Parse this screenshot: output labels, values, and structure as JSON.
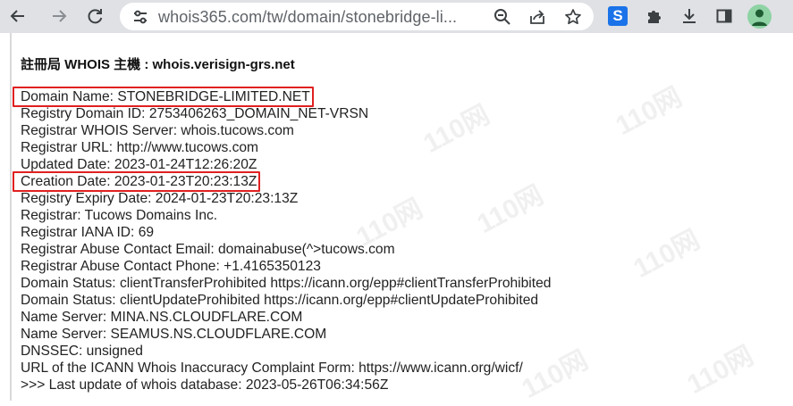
{
  "browser": {
    "url": "whois365.com/tw/domain/stonebridge-li...",
    "icons": {
      "back": "back-arrow-icon",
      "forward": "forward-arrow-icon",
      "reload": "reload-icon",
      "site_info": "tune-icon",
      "zoom": "zoom-icon",
      "share": "share-icon",
      "bookmark": "star-icon",
      "extension_s": "s-extension-icon",
      "extensions": "puzzle-icon",
      "download": "download-icon",
      "side_panel": "side-panel-icon",
      "profile": "profile-avatar-icon"
    },
    "extension_letter": "S"
  },
  "whois": {
    "heading": "註冊局 WHOIS 主機 : whois.verisign-grs.net",
    "records": [
      "Domain Name: STONEBRIDGE-LIMITED.NET",
      "Registry Domain ID: 2753406263_DOMAIN_NET-VRSN",
      "Registrar WHOIS Server: whois.tucows.com",
      "Registrar URL: http://www.tucows.com",
      "Updated Date: 2023-01-24T12:26:20Z",
      "Creation Date: 2023-01-23T20:23:13Z",
      "Registry Expiry Date: 2024-01-23T20:23:13Z",
      "Registrar: Tucows Domains Inc.",
      "Registrar IANA ID: 69",
      "Registrar Abuse Contact Email: domainabuse(^>tucows.com",
      "Registrar Abuse Contact Phone: +1.4165350123",
      "Domain Status: clientTransferProhibited https://icann.org/epp#clientTransferProhibited",
      "Domain Status: clientUpdateProhibited https://icann.org/epp#clientUpdateProhibited",
      "Name Server: MINA.NS.CLOUDFLARE.COM",
      "Name Server: SEAMUS.NS.CLOUDFLARE.COM",
      "DNSSEC: unsigned",
      "URL of the ICANN Whois Inaccuracy Complaint Form: https://www.icann.org/wicf/",
      ">>> Last update of whois database: 2023-05-26T06:34:56Z"
    ]
  },
  "watermark": "110网",
  "colors": {
    "toolbar_bg": "#dfe1e5",
    "highlight_box": "#e02020",
    "extension_s": "#1a73e8"
  }
}
